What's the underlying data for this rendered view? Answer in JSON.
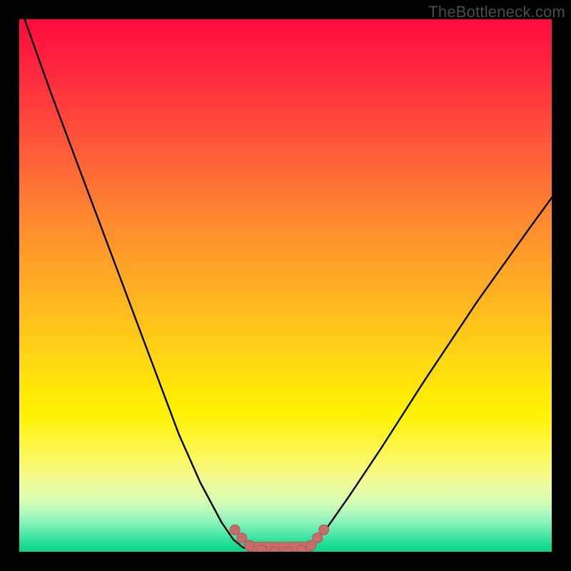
{
  "watermark": {
    "text": "TheBottleneck.com"
  },
  "colors": {
    "curve": "#000000",
    "marker_fill": "#c76b6b",
    "marker_stroke": "#b05a5a",
    "floor": "#c76b6b"
  },
  "chart_data": {
    "type": "line",
    "title": "",
    "xlabel": "",
    "ylabel": "",
    "xlim": [
      0,
      1
    ],
    "ylim": [
      0,
      1
    ],
    "grid": false,
    "legend": false,
    "notes": "V-shaped curve with flat trough; y ≈ mismatch/bottleneck magnitude (0 at green bottom, 1 at red top); x ≈ normalized hardware-balance parameter. Values estimated from pixels.",
    "series": [
      {
        "name": "bottleneck-curve",
        "x": [
          0.01,
          0.06,
          0.12,
          0.18,
          0.24,
          0.3,
          0.34,
          0.38,
          0.402,
          0.42,
          0.45,
          0.48,
          0.51,
          0.54,
          0.558,
          0.58,
          0.62,
          0.68,
          0.76,
          0.86,
          0.96,
          1.0
        ],
        "y": [
          1.0,
          0.86,
          0.7,
          0.54,
          0.38,
          0.22,
          0.13,
          0.055,
          0.023,
          0.008,
          0.0,
          0.0,
          0.0,
          0.008,
          0.023,
          0.048,
          0.105,
          0.195,
          0.32,
          0.47,
          0.61,
          0.665
        ]
      }
    ],
    "markers": {
      "name": "trough-markers",
      "x": [
        0.405,
        0.418,
        0.432,
        0.455,
        0.48,
        0.505,
        0.53,
        0.548,
        0.56,
        0.572
      ],
      "y": [
        0.041,
        0.026,
        0.012,
        0.003,
        0.0,
        0.0,
        0.003,
        0.012,
        0.026,
        0.041
      ]
    },
    "floor_bar": {
      "x0": 0.425,
      "x1": 0.552,
      "y": 0.0,
      "thickness_frac": 0.018
    }
  }
}
